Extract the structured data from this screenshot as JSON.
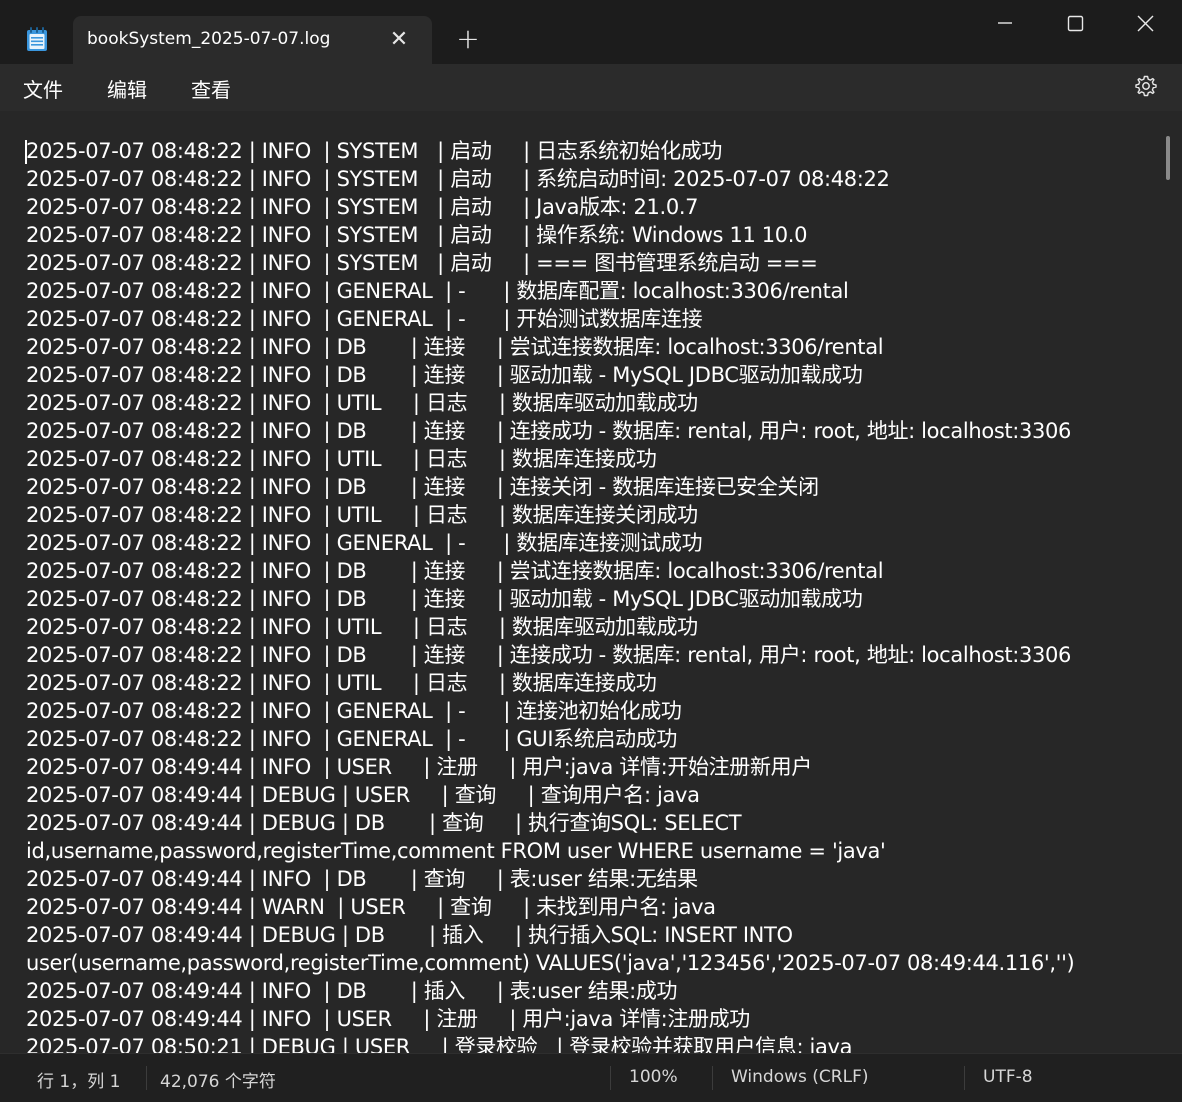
{
  "window": {
    "tab_title": "bookSystem_2025-07-07.log",
    "tab_close_glyph": "✕",
    "new_tab_glyph": "+",
    "accent_color": "#3a96dd"
  },
  "menu": {
    "file": "文件",
    "edit": "编辑",
    "view": "查看"
  },
  "editor": {
    "lines": [
      "2025-07-07 08:48:22 | INFO  | SYSTEM   | 启动     | 日志系统初始化成功",
      "2025-07-07 08:48:22 | INFO  | SYSTEM   | 启动     | 系统启动时间: 2025-07-07 08:48:22",
      "2025-07-07 08:48:22 | INFO  | SYSTEM   | 启动     | Java版本: 21.0.7",
      "2025-07-07 08:48:22 | INFO  | SYSTEM   | 启动     | 操作系统: Windows 11 10.0",
      "2025-07-07 08:48:22 | INFO  | SYSTEM   | 启动     | === 图书管理系统启动 ===",
      "2025-07-07 08:48:22 | INFO  | GENERAL  | -      | 数据库配置: localhost:3306/rental",
      "2025-07-07 08:48:22 | INFO  | GENERAL  | -      | 开始测试数据库连接",
      "2025-07-07 08:48:22 | INFO  | DB       | 连接     | 尝试连接数据库: localhost:3306/rental",
      "2025-07-07 08:48:22 | INFO  | DB       | 连接     | 驱动加载 - MySQL JDBC驱动加载成功",
      "2025-07-07 08:48:22 | INFO  | UTIL     | 日志     | 数据库驱动加载成功",
      "2025-07-07 08:48:22 | INFO  | DB       | 连接     | 连接成功 - 数据库: rental, 用户: root, 地址: localhost:3306",
      "2025-07-07 08:48:22 | INFO  | UTIL     | 日志     | 数据库连接成功",
      "2025-07-07 08:48:22 | INFO  | DB       | 连接     | 连接关闭 - 数据库连接已安全关闭",
      "2025-07-07 08:48:22 | INFO  | UTIL     | 日志     | 数据库连接关闭成功",
      "2025-07-07 08:48:22 | INFO  | GENERAL  | -      | 数据库连接测试成功",
      "2025-07-07 08:48:22 | INFO  | DB       | 连接     | 尝试连接数据库: localhost:3306/rental",
      "2025-07-07 08:48:22 | INFO  | DB       | 连接     | 驱动加载 - MySQL JDBC驱动加载成功",
      "2025-07-07 08:48:22 | INFO  | UTIL     | 日志     | 数据库驱动加载成功",
      "2025-07-07 08:48:22 | INFO  | DB       | 连接     | 连接成功 - 数据库: rental, 用户: root, 地址: localhost:3306",
      "2025-07-07 08:48:22 | INFO  | UTIL     | 日志     | 数据库连接成功",
      "2025-07-07 08:48:22 | INFO  | GENERAL  | -      | 连接池初始化成功",
      "2025-07-07 08:48:22 | INFO  | GENERAL  | -      | GUI系统启动成功",
      "2025-07-07 08:49:44 | INFO  | USER     | 注册     | 用户:java 详情:开始注册新用户",
      "2025-07-07 08:49:44 | DEBUG | USER     | 查询     | 查询用户名: java",
      "2025-07-07 08:49:44 | DEBUG | DB       | 查询     | 执行查询SQL: SELECT",
      "id,username,password,registerTime,comment FROM user WHERE username = 'java'",
      "2025-07-07 08:49:44 | INFO  | DB       | 查询     | 表:user 结果:无结果",
      "2025-07-07 08:49:44 | WARN  | USER     | 查询     | 未找到用户名: java",
      "2025-07-07 08:49:44 | DEBUG | DB       | 插入     | 执行插入SQL: INSERT INTO",
      "user(username,password,registerTime,comment) VALUES('java','123456','2025-07-07 08:49:44.116','')",
      "2025-07-07 08:49:44 | INFO  | DB       | 插入     | 表:user 结果:成功",
      "2025-07-07 08:49:44 | INFO  | USER     | 注册     | 用户:java 详情:注册成功",
      "2025-07-07 08:50:21 | DEBUG | USER     | 登录校验   | 登录校验并获取用户信息: java"
    ]
  },
  "status": {
    "position": "行 1，列 1",
    "char_count": "42,076 个字符",
    "zoom": "100%",
    "line_ending": "Windows (CRLF)",
    "encoding": "UTF-8"
  }
}
